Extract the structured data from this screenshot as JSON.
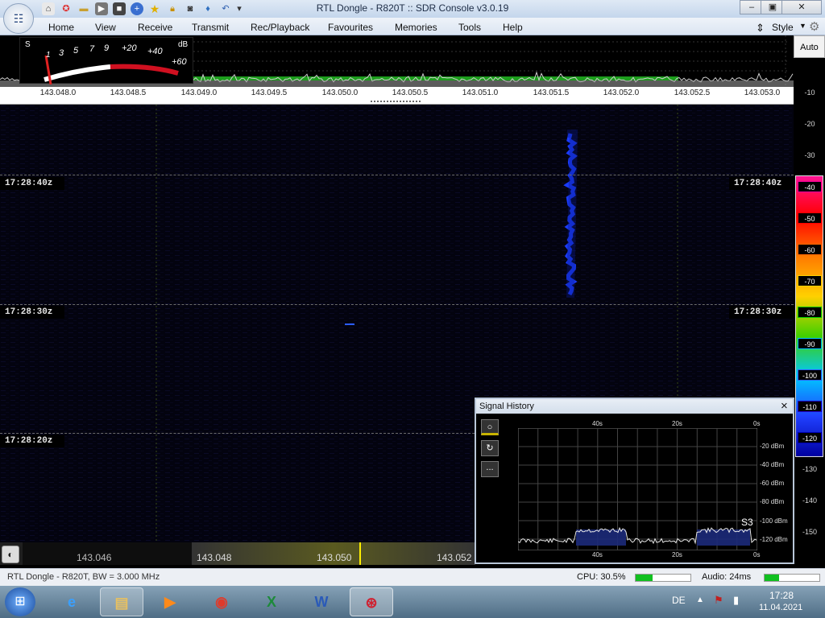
{
  "window": {
    "title": "RTL Dongle - R820T :: SDR Console v3.0.19"
  },
  "menu": [
    "Home",
    "View",
    "Receive",
    "Transmit",
    "Rec/Playback",
    "Favourites",
    "Memories",
    "Tools",
    "Help"
  ],
  "style_label": "Style",
  "meter": {
    "s_label": "S",
    "db_label": "dB",
    "scale": [
      "1",
      "3",
      "5",
      "7",
      "9",
      "+20",
      "+40",
      "+60"
    ]
  },
  "freq_ticks": [
    "143.048.0",
    "143.048.5",
    "143.049.0",
    "143.049.5",
    "143.050.0",
    "143.050.5",
    "143.051.0",
    "143.051.5",
    "143.052.0",
    "143.052.5",
    "143.053.0"
  ],
  "timestamps": [
    "17:28:40z",
    "17:28:30z",
    "17:28:20z"
  ],
  "scale": {
    "auto_label": "Auto",
    "ticks": [
      "-10",
      "-20",
      "-30",
      "-40",
      "-50",
      "-60",
      "-70",
      "-80",
      "-90",
      "-100",
      "-110",
      "-120",
      "-130",
      "-140",
      "-150"
    ],
    "colors": [
      "#000000",
      "#000000",
      "#000000",
      "#ff00a0",
      "#ff0000",
      "#ff6600",
      "#ffd000",
      "#00c800",
      "#00c0ff",
      "#3060ff",
      "#2000c0",
      "#0000b0",
      "#000000",
      "#000000",
      "#000000"
    ]
  },
  "band_bar": {
    "labels": [
      "143.046",
      "143.048",
      "143.050",
      "143.052"
    ]
  },
  "signal_history": {
    "title": "Signal History",
    "close": "×",
    "top_times": [
      "40s",
      "20s",
      "0s"
    ],
    "bottom_times": [
      "40s",
      "20s",
      "0s"
    ],
    "levels": [
      "-20 dBm",
      "-40 dBm",
      "-60 dBm",
      "-80 dBm",
      "-100 dBm",
      "-120 dBm"
    ],
    "s_reading": "S3",
    "more": "..."
  },
  "status": {
    "left": "RTL Dongle - R820T, BW = 3.000 MHz",
    "cpu": "CPU: 30.5%",
    "audio": "Audio: 24ms",
    "cpu_level": 0.305
  },
  "taskbar": {
    "lang": "DE",
    "time": "17:28",
    "date": "11.04.2021"
  }
}
